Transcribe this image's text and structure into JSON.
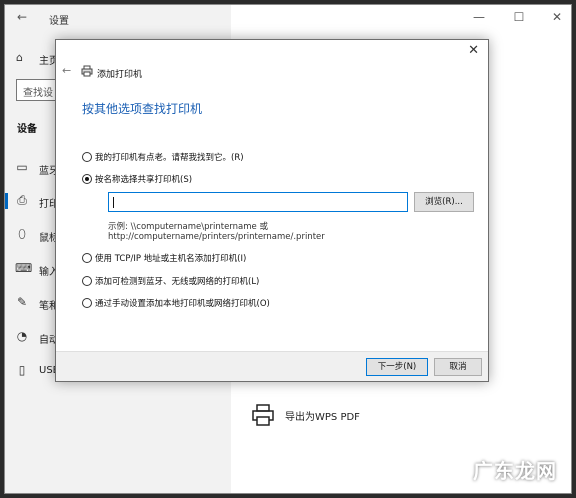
{
  "settings": {
    "back_glyph": "←",
    "title": "设置",
    "minimize_glyph": "—",
    "maximize_glyph": "☐",
    "close_glyph": "✕",
    "home_label": "主页",
    "search_placeholder": "查找设",
    "section_heading": "设备",
    "nav_items": [
      {
        "label": "蓝牙",
        "icon": "bluetooth-devices-icon"
      },
      {
        "label": "打印",
        "icon": "printer-icon",
        "active": true
      },
      {
        "label": "鼠标",
        "icon": "mouse-icon"
      },
      {
        "label": "输入",
        "icon": "keyboard-icon"
      },
      {
        "label": "笔和",
        "icon": "pen-icon"
      },
      {
        "label": "自动",
        "icon": "autoplay-icon"
      },
      {
        "label": "USB",
        "icon": "usb-icon"
      }
    ],
    "printer_entry": "导出为WPS PDF",
    "accent": "#0067c0"
  },
  "dialog": {
    "close_glyph": "✕",
    "back_glyph": "←",
    "title": "添加打印机",
    "heading": "按其他选项查找打印机",
    "options": [
      {
        "label": "我的打印机有点老。请帮我找到它。(R)",
        "checked": false
      },
      {
        "label": "按名称选择共享打印机(S)",
        "checked": true
      },
      {
        "label": "使用 TCP/IP 地址或主机名添加打印机(I)",
        "checked": false
      },
      {
        "label": "添加可检测到蓝牙、无线或网络的打印机(L)",
        "checked": false
      },
      {
        "label": "通过手动设置添加本地打印机或网络打印机(O)",
        "checked": false
      }
    ],
    "path_value": "",
    "browse_label": "浏览(R)...",
    "example_line1": "示例: \\\\computername\\printername 或",
    "example_line2": "http://computername/printers/printername/.printer",
    "next_label": "下一步(N)",
    "cancel_label": "取消",
    "heading_color": "#1a5fb4"
  },
  "watermark": "广东龙网"
}
